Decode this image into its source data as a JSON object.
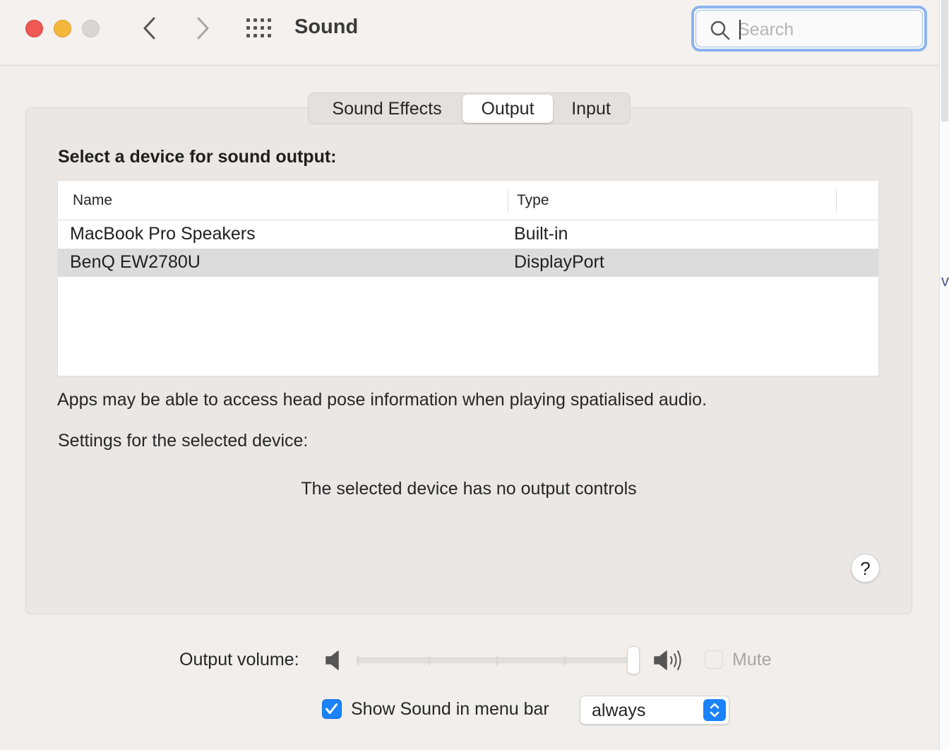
{
  "window": {
    "title": "Sound",
    "search_placeholder": "Search"
  },
  "tabs": [
    {
      "label": "Sound Effects",
      "selected": false
    },
    {
      "label": "Output",
      "selected": true
    },
    {
      "label": "Input",
      "selected": false
    }
  ],
  "output": {
    "heading": "Select a device for sound output:",
    "columns": [
      "Name",
      "Type"
    ],
    "devices": [
      {
        "name": "MacBook Pro Speakers",
        "type": "Built-in",
        "selected": false
      },
      {
        "name": "BenQ EW2780U",
        "type": "DisplayPort",
        "selected": true
      }
    ],
    "note": "Apps may be able to access head pose information when playing spatialised audio.",
    "settings_label": "Settings for the selected device:",
    "no_controls": "The selected device has no output controls"
  },
  "help_label": "?",
  "footer": {
    "volume_label": "Output volume:",
    "volume_level": 1.0,
    "mute_label": "Mute",
    "mute_checked": false,
    "show_in_menu_bar_label": "Show Sound in menu bar",
    "show_in_menu_bar_checked": true,
    "menu_bar_option": "always"
  },
  "colors": {
    "accent": "#1a82fb",
    "close": "#ee5a53",
    "minimize": "#f4b73c",
    "zoom_disabled": "#d9d6d4",
    "search_focus": "#8bb4ef"
  },
  "icons": {
    "back": "chevron-left-icon",
    "forward": "chevron-right-icon",
    "show_all": "grid-icon",
    "search": "search-icon",
    "volume_low": "speaker-low-icon",
    "volume_high": "speaker-high-icon",
    "checkmark": "checkmark-icon",
    "popup": "chevron-up-down-icon"
  }
}
